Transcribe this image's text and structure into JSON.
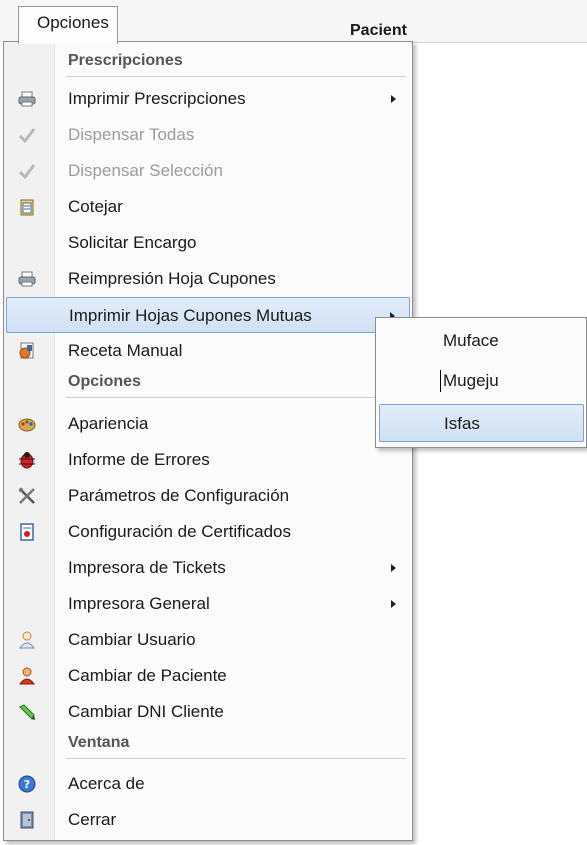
{
  "menubar": {
    "tab_label": "Opciones",
    "bg_header": "Pacient"
  },
  "menu": {
    "rows": [
      {
        "type": "header",
        "label": "Prescripciones"
      },
      {
        "type": "item",
        "label": "Imprimir Prescripciones",
        "icon": "printer-icon",
        "submenu": true
      },
      {
        "type": "item",
        "label": "Dispensar Todas",
        "icon": "check-icon",
        "disabled": true
      },
      {
        "type": "item",
        "label": "Dispensar Selección",
        "icon": "check-icon",
        "disabled": true
      },
      {
        "type": "item",
        "label": "Cotejar",
        "icon": "clipboard-icon"
      },
      {
        "type": "item",
        "label": "Solicitar Encargo"
      },
      {
        "type": "item",
        "label": "Reimpresión Hoja Cupones",
        "icon": "printer-icon"
      },
      {
        "type": "item",
        "label": "Imprimir Hojas Cupones Mutuas",
        "submenu": true,
        "highlight": true
      },
      {
        "type": "item",
        "label": "Receta Manual",
        "icon": "prescription-icon"
      },
      {
        "type": "header",
        "label": "Opciones"
      },
      {
        "type": "item",
        "label": "Apariencia",
        "icon": "palette-icon"
      },
      {
        "type": "item",
        "label": "Informe de Errores",
        "icon": "bug-icon"
      },
      {
        "type": "item",
        "label": "Parámetros de Configuración",
        "icon": "tools-icon"
      },
      {
        "type": "item",
        "label": "Configuración de Certificados",
        "icon": "certificate-icon"
      },
      {
        "type": "item",
        "label": "Impresora de Tickets",
        "submenu": true
      },
      {
        "type": "item",
        "label": "Impresora General",
        "submenu": true
      },
      {
        "type": "item",
        "label": "Cambiar Usuario",
        "icon": "user-outline-icon"
      },
      {
        "type": "item",
        "label": "Cambiar de Paciente",
        "icon": "patient-icon"
      },
      {
        "type": "item",
        "label": "Cambiar DNI Cliente",
        "icon": "pencil-icon"
      },
      {
        "type": "header",
        "label": "Ventana"
      },
      {
        "type": "item",
        "label": "Acerca de",
        "icon": "help-icon"
      },
      {
        "type": "item",
        "label": "Cerrar",
        "icon": "door-icon"
      }
    ]
  },
  "submenu": {
    "items": [
      {
        "label": "Muface"
      },
      {
        "label": "Mugeju"
      },
      {
        "label": "Isfas",
        "highlight": true
      }
    ]
  }
}
